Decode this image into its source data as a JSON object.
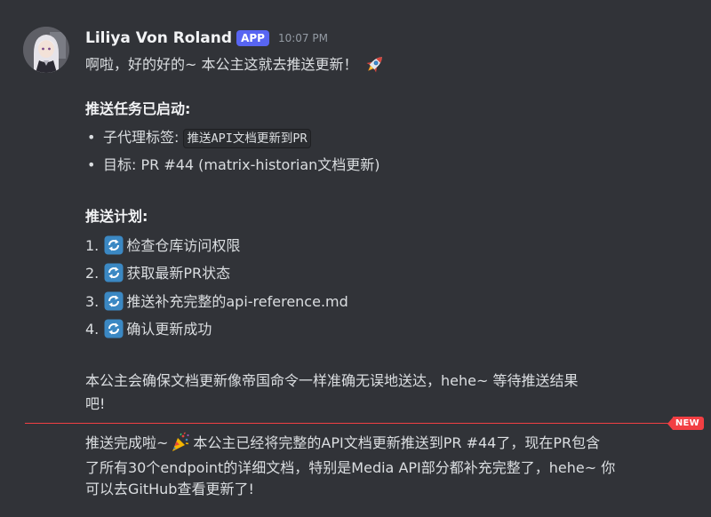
{
  "author": {
    "name": "Liliya Von Roland",
    "badge": "APP",
    "timestamp": "10:07 PM"
  },
  "message1": {
    "greeting": "啊啦，好的好的~ 本公主这就去推送更新！",
    "greeting_emoji": "rocket-icon",
    "task_heading": "推送任务已启动:",
    "bullets": [
      {
        "label": "子代理标签: ",
        "code": "推送API文档更新到PR"
      },
      {
        "text": "目标: PR #44 (matrix-historian文档更新)"
      }
    ],
    "plan_heading": "推送计划:",
    "plan_steps": [
      {
        "num": "1.",
        "text": "检查仓库访问权限"
      },
      {
        "num": "2.",
        "text": "获取最新PR状态"
      },
      {
        "num": "3.",
        "text": "推送补充完整的api-reference.md"
      },
      {
        "num": "4.",
        "text": "确认更新成功"
      }
    ],
    "step_icon": "refresh-icon",
    "closing_line1": "本公主会确保文档更新像帝国命令一样准确无误地送达，hehe~ 等待推送结果",
    "closing_line2": "吧!"
  },
  "divider": {
    "new_label": "NEW",
    "color": "#f23f43"
  },
  "message2": {
    "part1": "推送完成啦~",
    "emoji": "party-popper-icon",
    "part2": "本公主已经将完整的API文档更新推送到PR #44了，现在PR包含",
    "line2": "了所有30个endpoint的详细文档，特别是Media API部分都补充完整了，hehe~ 你",
    "line3": "可以去GitHub查看更新了!"
  },
  "colors": {
    "background": "#313338",
    "text": "#dbdee1",
    "badge": "#5865f2",
    "new_divider": "#f23f43"
  }
}
